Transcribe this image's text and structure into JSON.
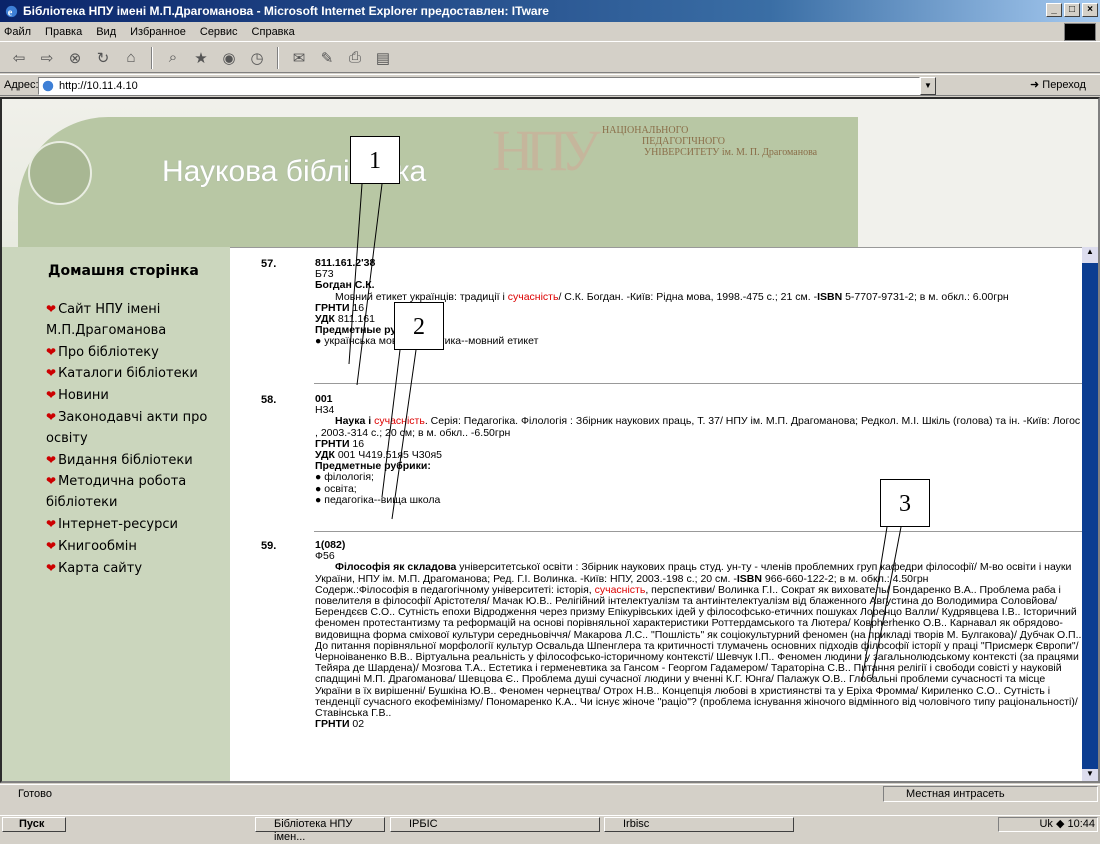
{
  "window": {
    "title": "Бібліотека НПУ імені М.П.Драгоманова - Microsoft Internet Explorer предоставлен: ITware"
  },
  "menu": [
    "Файл",
    "Правка",
    "Вид",
    "Избранное",
    "Сервис",
    "Справка"
  ],
  "address": {
    "label": "Адрес:",
    "url": "http://10.11.4.10",
    "go": "Переход"
  },
  "banner": {
    "title": "Наукова бібліотека",
    "logo": {
      "big": "НПУ",
      "l1": "НАЦІОНАЛЬНОГО",
      "l2": "ПЕДАГОГІЧНОГО",
      "l3": "УНІВЕРСИТЕТУ ім. М. П. Драгоманова"
    }
  },
  "nav": {
    "heading": "Домашня сторінка",
    "items": [
      "Сайт НПУ імені М.П.Драгоманова",
      "Про бібліотеку",
      "Каталоги бібліотеки",
      "Новини",
      "Законодавчі акти про освіту",
      "Видання бібліотеки",
      "Методична робота бібліотеки",
      "Інтернет-ресурси",
      "Книгообмін",
      "Карта сайту"
    ]
  },
  "records": [
    {
      "num": "57.",
      "code": "811.161.2'38",
      "author_code": "Б73",
      "author": "Богдан С.К.",
      "text_a": "Мовний етикет українців: традиції і ",
      "hl": "сучасність",
      "text_b": "/ С.К. Богдан. -Київ: Рідна мова, 1998.-475 с.; 21 см. -",
      "isbn_label": "ISBN",
      "isbn": " 5-7707-9731-2; в м. обкл.: 6.00грн",
      "grnti": "16",
      "udk": "811.161",
      "rubrics_label": "Предметные рубрики:",
      "rubrics": [
        "українська мова--стилістика--мовний етикет"
      ]
    },
    {
      "num": "58.",
      "code": "001",
      "author_code": "Н34",
      "title_a": "Наука і ",
      "hl": "сучасність",
      "text_b": ". Серія: Педагогіка. Філологія : Збірник наукових праць, Т. 37/ НПУ ім. М.П. Драгоманова; Редкол. М.І. Шкіль (голова) та ін. -Київ: Логос , 2003.-314 с.; 20 см; в м. обкл.. -6.50грн",
      "grnti": "16",
      "udk": "001 Ч419.51я5 Ч30я5",
      "rubrics_label": "Предметные рубрики:",
      "rubrics": [
        "філологія;",
        "освіта;",
        "педагогіка--вища школа"
      ]
    },
    {
      "num": "59.",
      "code": "1(082)",
      "author_code": "Ф56",
      "title": "Філософія як складова",
      "text_a": " університетської освіти : Збірник наукових праць студ. ун-ту - членів проблемних груп кафедри філософії/ М-во освіти і науки України, НПУ ім. М.П. Драгоманова; Ред. Г.І. Волинка. -Київ: НПУ, 2003.-198 с.; 20 см. -",
      "isbn_label": "ISBN",
      "isbn": " 966-660-122-2; в м. обкл.: 4.50грн",
      "contents_a": "Содерж.:Філософія в педагогічному університеті: історія, ",
      "hl": "сучасність",
      "contents_b": ", перспективи/ Волинка Г.І.. Сократ як вихователь/ Бондаренко В.А.. Проблема раба і повелителя в філософії Арістотеля/ Мачак Ю.В.. Релігійний інтелектуалізм та антиінтелектуалізм від блаженного Августина до Володимира Соловйова/ Берендєєв С.О.. Сутність епохи Відродження через призму Епікурівських ідей у філософсько-етичних пошуках Лоренцо Валли/ Кудрявцева І.В.. Історичний феномен протестантизму та реформацій на основі порівняльної характеристики Роттердамського та Лютера/ Коврherhенко О.В.. Карнавал як обрядово-видовищна форма сміхової культури середньовіччя/ Макарова Л.С.. \"Пошлість\" як соціокультурний феномен (на прикладі творів М. Булгакова)/ Дубчак О.П.. До питання порівняльної морфології культур Освальда Шпенглера та критичності тлумачень основних підходів філософії історії у праці \"Присмерк Європи\"/ Черноіваненко В.В.. Віртуальна реальність у філософсько-історичному контексті/ Шевчук І.П.. Феномен людини у загальнолюдському контексті (за працями Тейяра де Шардена)/ Мозгова Т.А.. Естетика і герменевтика за Гансом - Георгом Гадамером/ Тараторіна С.В.. Питання релігії і свободи совісті у науковій спадщині М.П. Драгоманова/ Шевцова Є.. Проблема душі сучасної людини у вченні К.Г. Юнга/ Палажук О.В.. Глобальні проблеми сучасності та місце України в їх вирішенні/ Бушкіна Ю.В.. Феномен чернецтва/ Отрох Н.В.. Концепція любові в християнстві та у Еріха Фромма/ Кириленко С.О.. Сутність і тенденції сучасного екофемінізму/ Пономаренко К.А.. Чи існує жіноче \"раціо\"? (проблема існування жіночого відмінного від чоловічого типу раціональності)/ Ставінська Г.В..",
      "grnti": "02"
    }
  ],
  "labels": {
    "grnti": "ГРНТИ",
    "udk": "УДК"
  },
  "callouts": [
    "1",
    "2",
    "3"
  ],
  "status": {
    "text": "Готово",
    "zone": "Местная интрасеть"
  },
  "taskbar": {
    "start": "Пуск",
    "tasks": [
      "Бібліотека НПУ імен...",
      "IРБІС",
      "Irbisc"
    ],
    "clock": "10:44",
    "lang": "Uk"
  }
}
